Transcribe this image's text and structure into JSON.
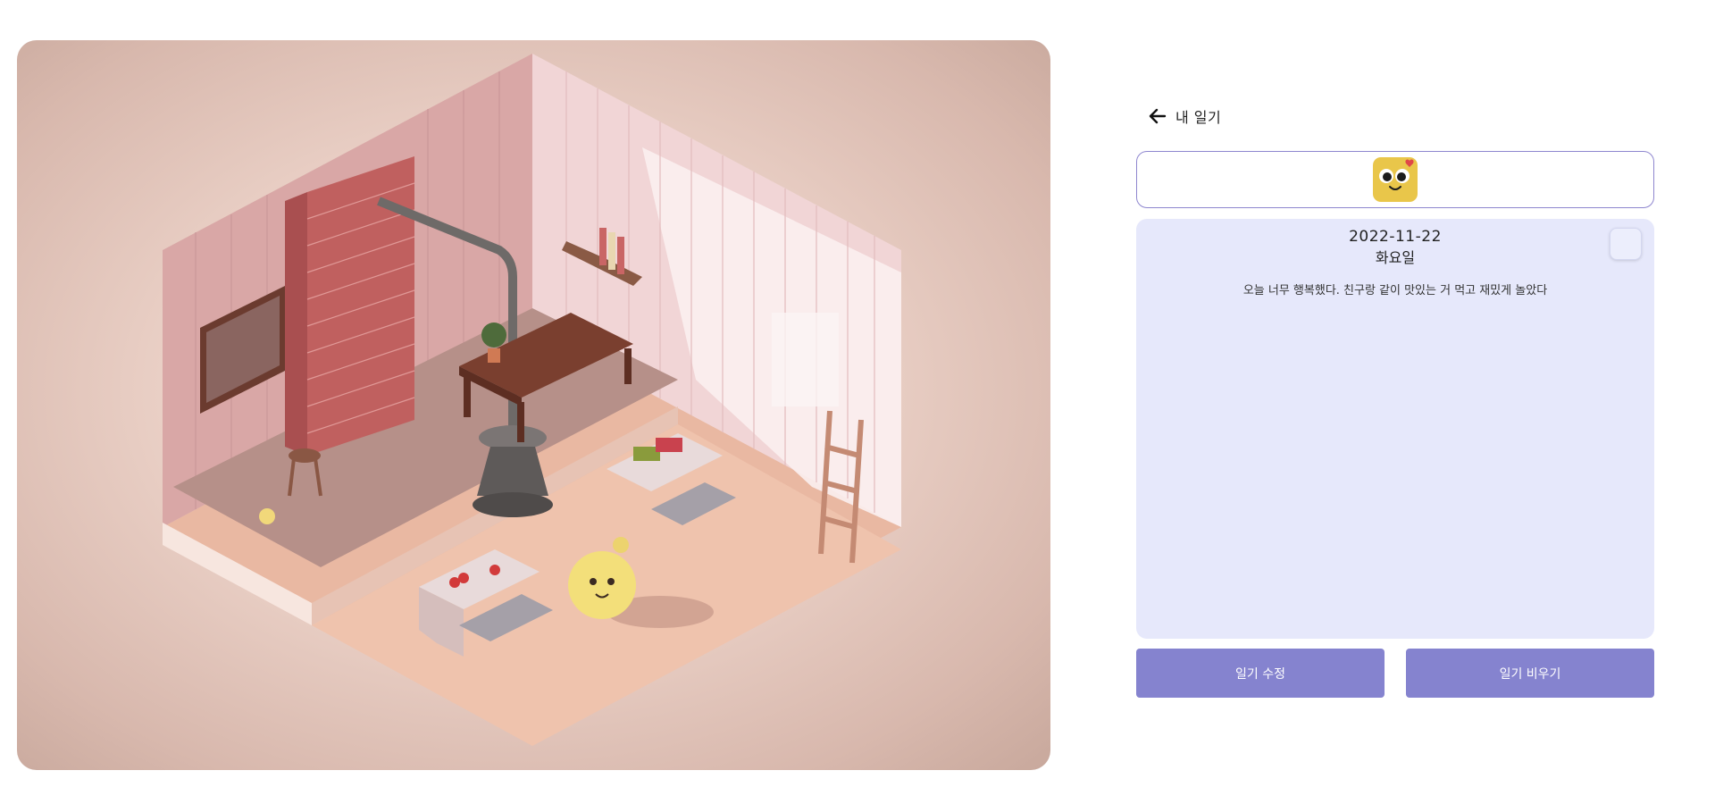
{
  "header": {
    "back_label": "내 일기",
    "back_icon": "arrow-left-icon"
  },
  "emoji": {
    "icon": "smiling-face-with-heart-icon",
    "color": "#e9c64a"
  },
  "diary": {
    "date": "2022-11-22",
    "weekday": "화요일",
    "text": "오늘 너무 행복했다. 친구랑 같이 맛있는 거 먹고 재밌게 놀았다"
  },
  "actions": {
    "edit_label": "일기 수정",
    "clear_label": "일기 비우기"
  },
  "colors": {
    "accent": "#8583cf",
    "panel_bg": "#e6e8fb",
    "border": "#8e86cf"
  }
}
